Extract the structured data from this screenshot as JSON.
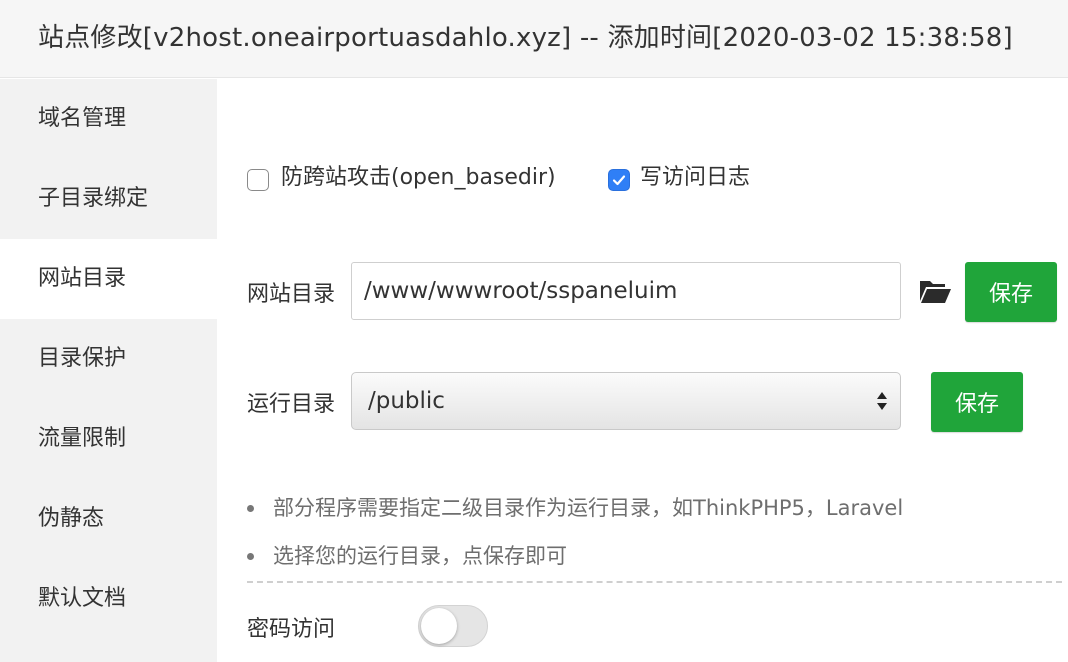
{
  "header": {
    "title": "站点修改[v2host.oneairportuasdahlo.xyz] -- 添加时间[2020-03-02 15:38:58]"
  },
  "sidebar": {
    "items": [
      {
        "label": "域名管理",
        "active": false
      },
      {
        "label": "子目录绑定",
        "active": false
      },
      {
        "label": "网站目录",
        "active": true
      },
      {
        "label": "目录保护",
        "active": false
      },
      {
        "label": "流量限制",
        "active": false
      },
      {
        "label": "伪静态",
        "active": false
      },
      {
        "label": "默认文档",
        "active": false
      }
    ]
  },
  "options": {
    "anti_cross_site": {
      "label": "防跨站攻击(open_basedir)",
      "checked": false
    },
    "write_access_log": {
      "label": "写访问日志",
      "checked": true
    }
  },
  "site_dir": {
    "label": "网站目录",
    "value": "/www/wwwroot/sspaneluim",
    "folder_icon": "folder-open-icon",
    "save_label": "保存"
  },
  "run_dir": {
    "label": "运行目录",
    "value": "/public",
    "save_label": "保存"
  },
  "hints": [
    "部分程序需要指定二级目录作为运行目录，如ThinkPHP5，Laravel",
    "选择您的运行目录，点保存即可"
  ],
  "password_access": {
    "label": "密码访问",
    "enabled": false
  },
  "colors": {
    "accent_green": "#20a53a",
    "checkbox_blue": "#2f7ff6",
    "sidebar_bg": "#f2f2f2",
    "header_bg": "#f6f6f6"
  }
}
